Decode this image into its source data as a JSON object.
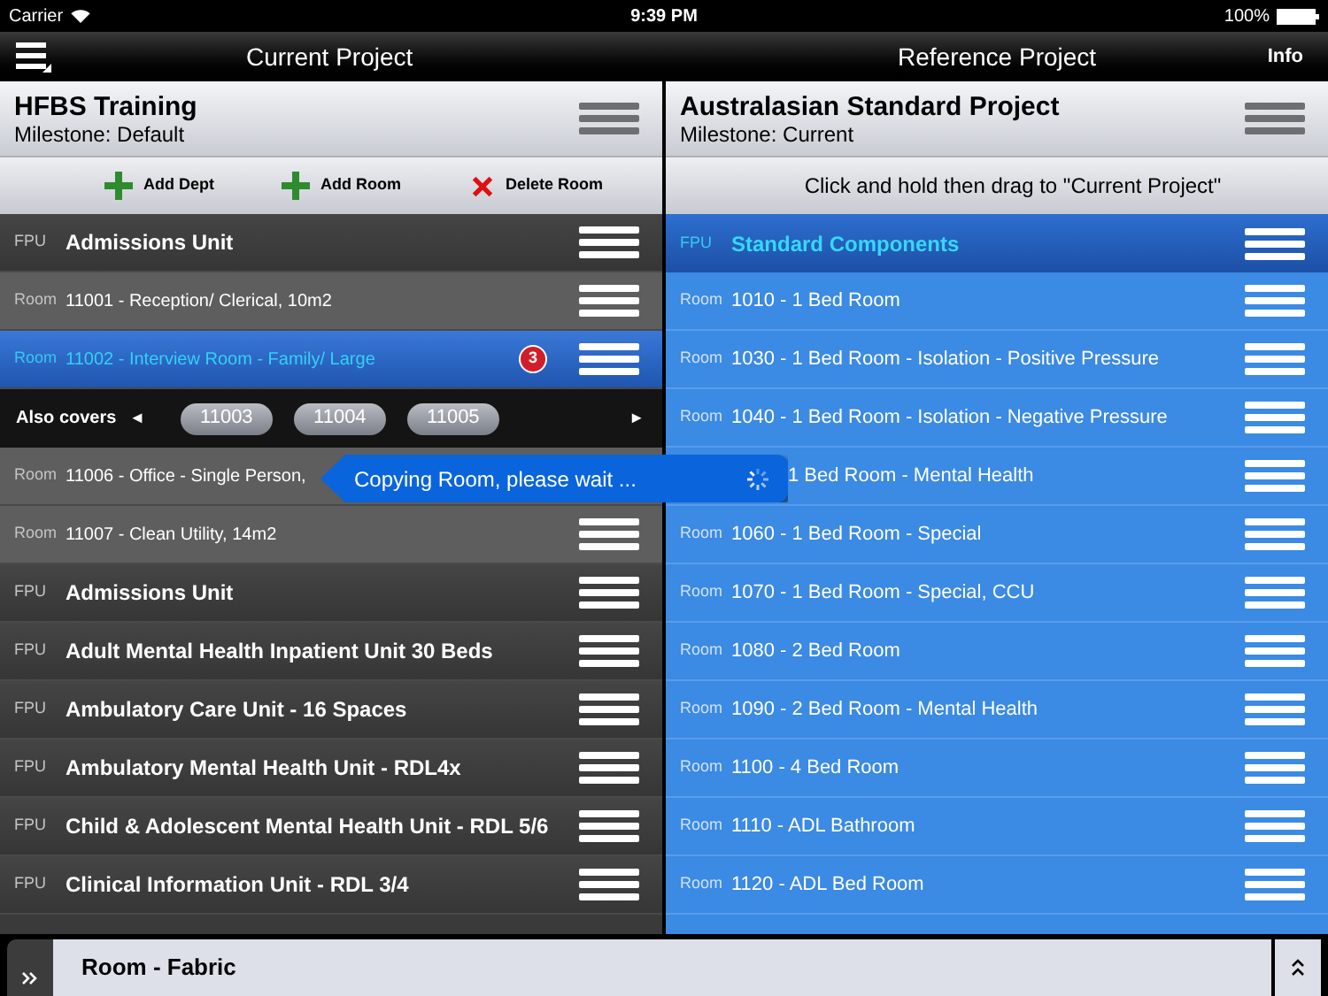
{
  "status_bar": {
    "carrier": "Carrier",
    "time": "9:39 PM",
    "battery": "100%"
  },
  "nav": {
    "left_title": "Current Project",
    "right_title": "Reference Project",
    "info": "Info"
  },
  "current": {
    "title": "HFBS Training",
    "milestone": "Milestone: Default",
    "actions": [
      {
        "label": "Add Dept",
        "kind": "add"
      },
      {
        "label": "Add Room",
        "kind": "add"
      },
      {
        "label": "Delete Room",
        "kind": "delete"
      }
    ],
    "rows": [
      {
        "kind": "fpu",
        "type": "FPU",
        "text": "Admissions Unit",
        "selected": false,
        "menu": true
      },
      {
        "kind": "room",
        "type": "Room",
        "text": "11001 - Reception/ Clerical, 10m2",
        "selected": false,
        "menu": true
      },
      {
        "kind": "room",
        "type": "Room",
        "text": "11002 - Interview Room - Family/ Large",
        "selected": true,
        "badge": "3",
        "menu": true
      },
      {
        "kind": "covers",
        "label": "Also covers",
        "prev": "◄",
        "next": "►",
        "chips": [
          "11003",
          "11004",
          "11005"
        ]
      },
      {
        "kind": "room",
        "type": "Room",
        "text": "11006 - Office - Single Person,",
        "selected": false,
        "menu": false
      },
      {
        "kind": "room",
        "type": "Room",
        "text": "11007 - Clean Utility, 14m2",
        "selected": false,
        "menu": true
      },
      {
        "kind": "fpu",
        "type": "FPU",
        "text": "Admissions Unit",
        "selected": false,
        "menu": true
      },
      {
        "kind": "fpu",
        "type": "FPU",
        "text": "Adult Mental Health Inpatient Unit 30 Beds",
        "selected": false,
        "menu": true
      },
      {
        "kind": "fpu",
        "type": "FPU",
        "text": "Ambulatory Care Unit - 16 Spaces",
        "selected": false,
        "menu": true
      },
      {
        "kind": "fpu",
        "type": "FPU",
        "text": "Ambulatory Mental Health Unit - RDL4x",
        "selected": false,
        "menu": true
      },
      {
        "kind": "fpu",
        "type": "FPU",
        "text": "Child & Adolescent Mental Health Unit - RDL 5/6",
        "selected": false,
        "menu": true
      },
      {
        "kind": "fpu",
        "type": "FPU",
        "text": "Clinical Information Unit - RDL 3/4",
        "selected": false,
        "menu": true
      }
    ]
  },
  "reference": {
    "title": "Australasian Standard Project",
    "milestone": "Milestone: Current",
    "hint": "Click and hold then drag to \"Current Project\"",
    "rows": [
      {
        "kind": "fpu",
        "type": "FPU",
        "text": "Standard Components"
      },
      {
        "kind": "room",
        "type": "Room",
        "text": "1010 - 1 Bed Room"
      },
      {
        "kind": "room",
        "type": "Room",
        "text": "1030 - 1 Bed Room - Isolation - Positive Pressure"
      },
      {
        "kind": "room",
        "type": "Room",
        "text": "1040 - 1 Bed Room - Isolation - Negative Pressure"
      },
      {
        "kind": "covered",
        "text": "1 Bed Room - Mental Health"
      },
      {
        "kind": "room",
        "type": "Room",
        "text": "1060 - 1 Bed Room - Special"
      },
      {
        "kind": "room",
        "type": "Room",
        "text": "1070 - 1 Bed Room - Special, CCU"
      },
      {
        "kind": "room",
        "type": "Room",
        "text": "1080 - 2 Bed Room"
      },
      {
        "kind": "room",
        "type": "Room",
        "text": "1090 - 2 Bed Room - Mental Health"
      },
      {
        "kind": "room",
        "type": "Room",
        "text": "1100 - 4 Bed Room"
      },
      {
        "kind": "room",
        "type": "Room",
        "text": "1110 - ADL Bathroom"
      },
      {
        "kind": "room",
        "type": "Room",
        "text": "1120 - ADL Bed Room"
      }
    ]
  },
  "toast": {
    "text": "Copying Room, please wait ..."
  },
  "bottom_panel": {
    "title": "Room - Fabric"
  }
}
